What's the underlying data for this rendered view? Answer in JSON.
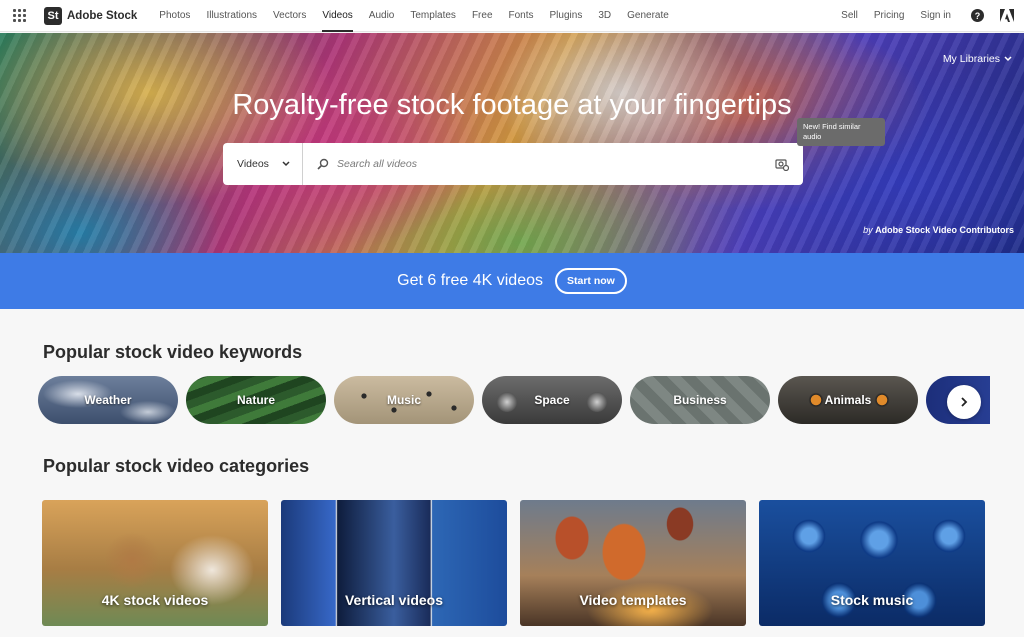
{
  "nav": {
    "brand_badge": "St",
    "brand": "Adobe Stock",
    "links": [
      "Photos",
      "Illustrations",
      "Vectors",
      "Videos",
      "Audio",
      "Templates",
      "Free",
      "Fonts",
      "Plugins",
      "3D",
      "Generate"
    ],
    "active": "Videos",
    "right": [
      "Sell",
      "Pricing",
      "Sign in"
    ],
    "help_glyph": "?"
  },
  "hero": {
    "my_libraries": "My Libraries",
    "title": "Royalty-free stock footage at your fingertips",
    "search_type": "Videos",
    "search_placeholder": "Search all videos",
    "tooltip": "New! Find similar audio",
    "credit_by": "by",
    "credit_name": "Adobe Stock Video Contributors"
  },
  "promo": {
    "text": "Get 6 free 4K videos",
    "button": "Start now"
  },
  "keywords": {
    "title": "Popular stock video keywords",
    "items": [
      "Weather",
      "Nature",
      "Music",
      "Space",
      "Business",
      "Animals"
    ]
  },
  "categories": {
    "title": "Popular stock video categories",
    "items": [
      "4K stock videos",
      "Vertical videos",
      "Video templates",
      "Stock music"
    ]
  },
  "icons": {
    "apps": "apps-grid-icon",
    "search": "search-icon",
    "camera": "visual-search-icon",
    "chevron": "chevron-down-icon",
    "next": "chevron-right-icon",
    "adobe": "adobe-logo-icon"
  },
  "colors": {
    "promo_blue": "#3e7be6",
    "nav_text": "#555555",
    "dark": "#2c2c2c"
  }
}
